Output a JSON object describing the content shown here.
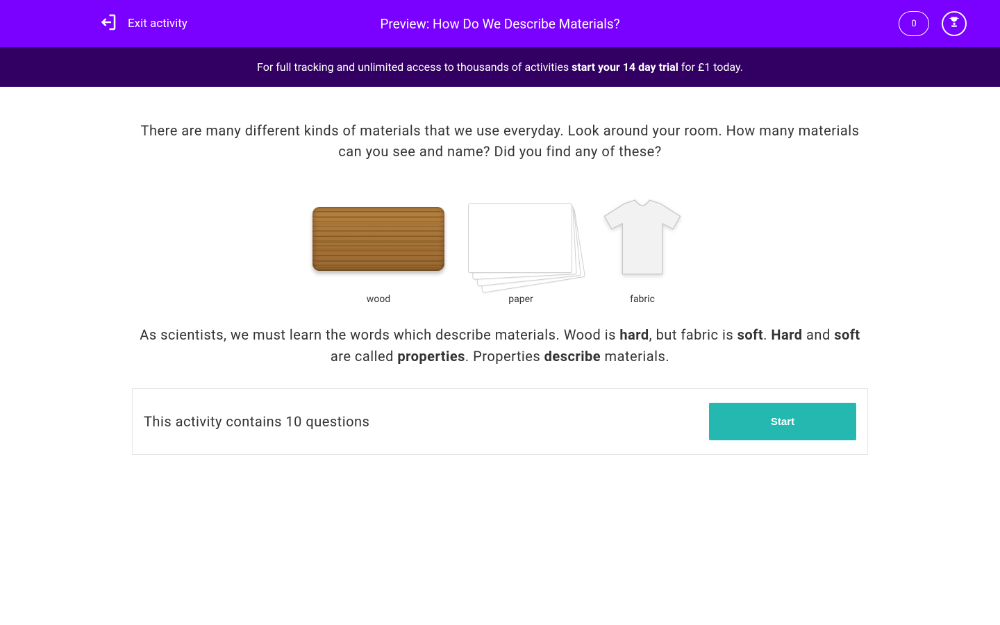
{
  "header": {
    "exit_label": "Exit activity",
    "title": "Preview: How Do We Describe Materials?",
    "score": "0"
  },
  "banner": {
    "prefix": "For full tracking and unlimited access to thousands of activities ",
    "bold": "start your 14 day trial",
    "suffix": " for £1 today."
  },
  "intro": "There are many different kinds of materials that we use everyday. Look around your room. How many materials can you see and name? Did you find any of these?",
  "materials": {
    "wood": "wood",
    "paper": "paper",
    "fabric": "fabric"
  },
  "properties": {
    "seg1": "As scientists, we must learn the words which describe materials. Wood is ",
    "b1": "hard",
    "seg2": ", but fabric is ",
    "b2": "soft",
    "seg3": ". ",
    "b3": "Hard",
    "seg4": " and ",
    "b4": "soft",
    "seg5": " are called ",
    "b5": "properties",
    "seg6": ". Properties ",
    "b6": "describe",
    "seg7": " materials."
  },
  "activity_count": "This activity contains 10 questions",
  "start_label": "Start"
}
